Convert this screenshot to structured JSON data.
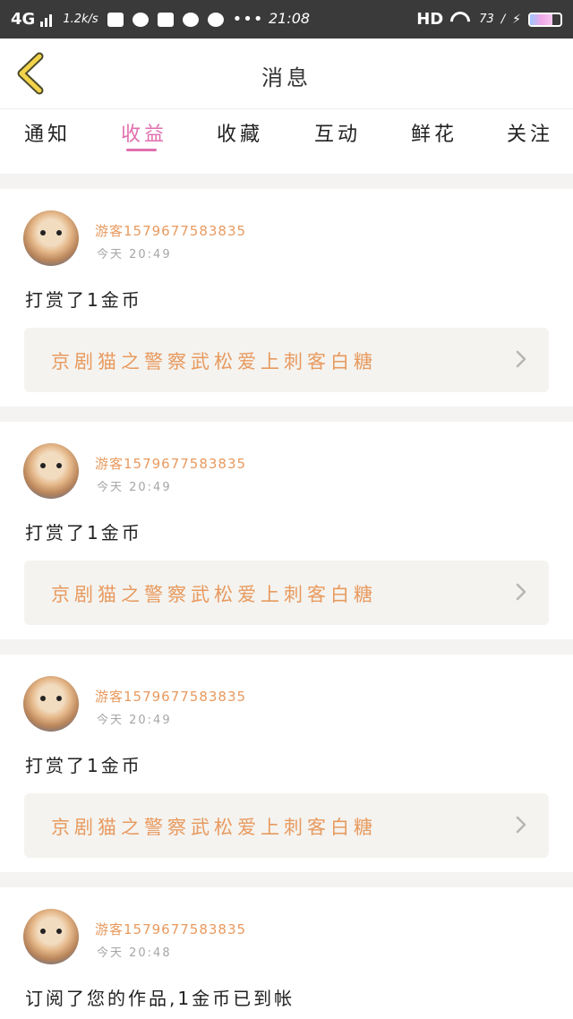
{
  "status_bar": {
    "network": "4G",
    "speed": "1.2k/s",
    "time": "21:08",
    "hd": "HD",
    "battery": "73"
  },
  "header": {
    "title": "消息",
    "back_icon": "chevron-left-icon"
  },
  "tabs": [
    {
      "label": "通知"
    },
    {
      "label": "收益",
      "active": true
    },
    {
      "label": "收藏"
    },
    {
      "label": "互动"
    },
    {
      "label": "鲜花"
    },
    {
      "label": "关注"
    }
  ],
  "colors": {
    "accent": "#e06fae",
    "username": "#e89a5f",
    "status_bar": "#3a3a3a"
  },
  "messages": [
    {
      "user": "游客1579677583835",
      "time": "今天 20:49",
      "text": "打赏了1金币",
      "link": "京剧猫之警察武松爱上刺客白糖"
    },
    {
      "user": "游客1579677583835",
      "time": "今天 20:49",
      "text": "打赏了1金币",
      "link": "京剧猫之警察武松爱上刺客白糖"
    },
    {
      "user": "游客1579677583835",
      "time": "今天 20:49",
      "text": "打赏了1金币",
      "link": "京剧猫之警察武松爱上刺客白糖"
    },
    {
      "user": "游客1579677583835",
      "time": "今天 20:48",
      "text": "订阅了您的作品,1金币已到帐"
    }
  ]
}
